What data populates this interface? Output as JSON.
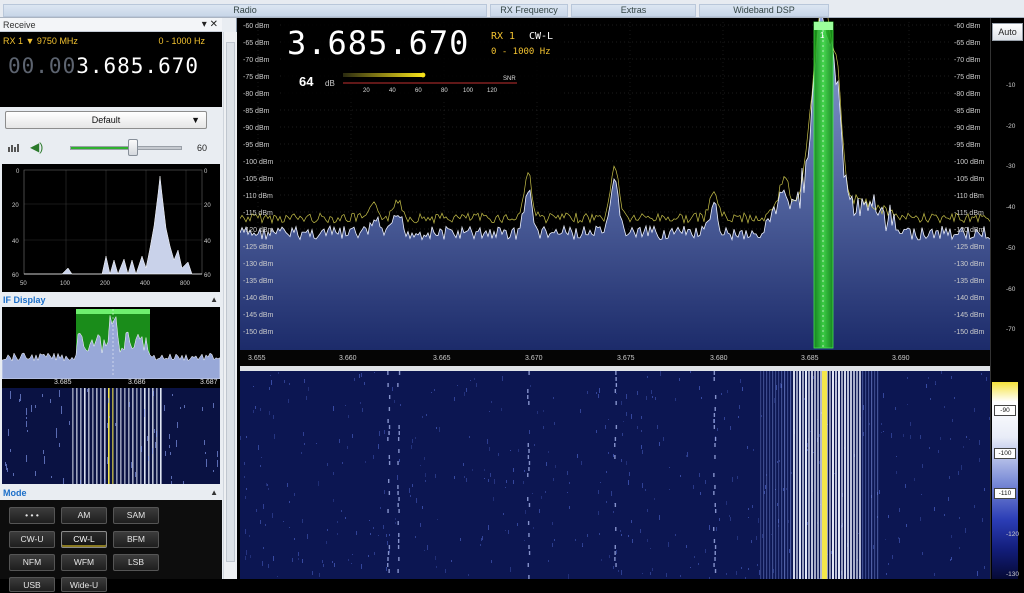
{
  "ribbon": {
    "tabs": [
      "Radio",
      "RX Frequency",
      "Extras",
      "Wideband DSP"
    ]
  },
  "receive": {
    "title": "Receive",
    "pin_icon": "pin-icon",
    "close_icon": "close-icon",
    "rx_label": "RX 1 ▼ 9750 MHz",
    "bandwidth": "0 - 1000 Hz",
    "freq_dim": "00.00",
    "freq_main": "3.685.670",
    "preset": "Default",
    "volume": "60",
    "volume_fraction": 0.6
  },
  "audio_spectrum": {
    "x_ticks": [
      "50",
      "100",
      "200",
      "400",
      "800"
    ],
    "y_ticks_left": [
      "0",
      "20",
      "40",
      "60"
    ],
    "y_ticks_right": [
      "0",
      "20",
      "40",
      "60"
    ]
  },
  "if_display": {
    "title": "IF Display",
    "scale": [
      "3.685",
      "3.686",
      "3.687"
    ]
  },
  "mode": {
    "title": "Mode",
    "buttons": [
      "• • •",
      "AM",
      "SAM",
      "CW-U",
      "CW-L",
      "BFM",
      "NFM",
      "WFM",
      "LSB",
      "USB",
      "Wide-U"
    ],
    "active": "CW-L"
  },
  "overlay": {
    "freq": "3.685.670",
    "rx": "RX 1",
    "mode": "CW-L",
    "bw": "0 - 1000 Hz",
    "snr_value": "64",
    "snr_unit": "dB",
    "snr_label": "SNR",
    "snr_ticks": [
      "20",
      "40",
      "60",
      "80",
      "100",
      "120"
    ]
  },
  "spectrum": {
    "db_labels": [
      "-60 dBm",
      "-65 dBm",
      "-70 dBm",
      "-75 dBm",
      "-80 dBm",
      "-85 dBm",
      "-90 dBm",
      "-95 dBm",
      "-100 dBm",
      "-105 dBm",
      "-110 dBm",
      "-115 dBm",
      "-120 dBm",
      "-125 dBm",
      "-130 dBm",
      "-135 dBm",
      "-140 dBm",
      "-145 dBm",
      "-150 dBm"
    ],
    "freq_ticks": [
      "3.655",
      "3.660",
      "3.665",
      "3.670",
      "3.675",
      "3.680",
      "3.685",
      "3.690"
    ],
    "vfo_number": "1",
    "colors": {
      "fill_top": "#8ea3d9",
      "fill_bottom": "#1c2b6a",
      "peak_hold": "#c8c24a",
      "vfo": "#2fd12f"
    }
  },
  "right_scale": {
    "auto": "Auto",
    "spectrum_ticks": [
      "-10",
      "-20",
      "-30",
      "-40",
      "-50",
      "-60",
      "-70"
    ],
    "waterfall_labels": [
      "-90",
      "-100",
      "-110"
    ],
    "waterfall_ticks": [
      "-120",
      "-130"
    ]
  }
}
